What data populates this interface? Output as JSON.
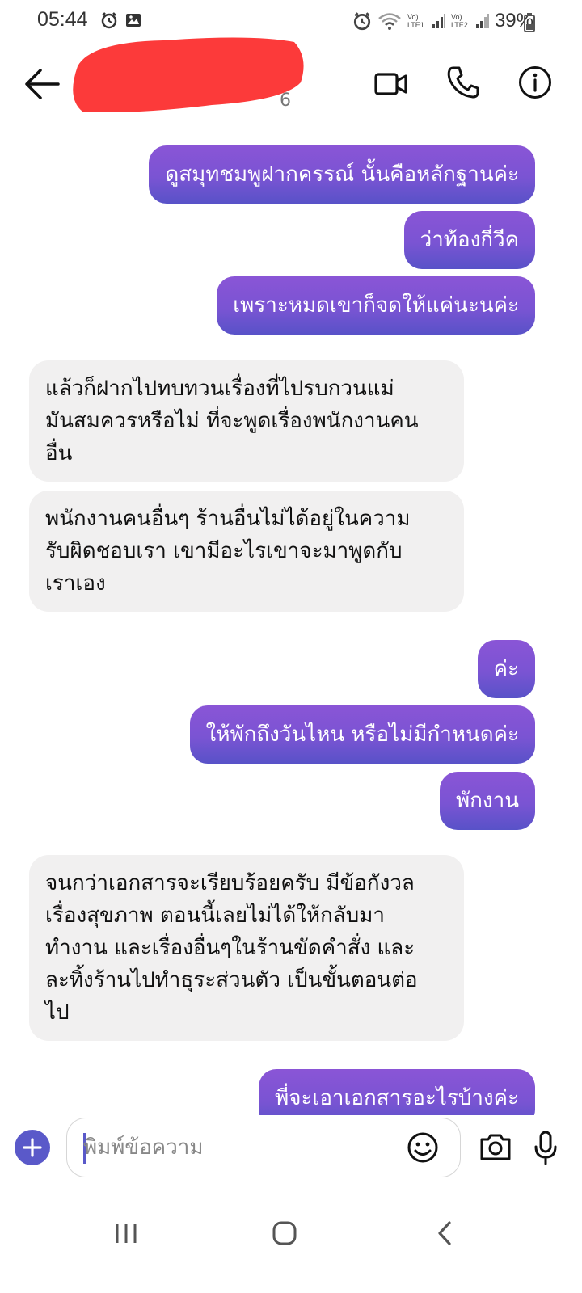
{
  "status_bar": {
    "time": "05:44",
    "battery": "39%",
    "sim1_label": "Vo) LTE1",
    "sim2_label": "Vo) LTE2"
  },
  "header": {
    "contact_name": "",
    "contact_status": "6",
    "redaction_color": "#fc3a3a"
  },
  "colors": {
    "outgoing_gradient_start": "#8a55d6",
    "outgoing_gradient_mid": "#7a54d3",
    "outgoing_gradient_end": "#5852c8",
    "incoming_bg": "#f1f0f0",
    "accent": "#5a59c9"
  },
  "messages": [
    {
      "dir": "out",
      "text": "ดูสมุทชมพูฝากครรณ์ นั้นคือหลักฐานค่ะ"
    },
    {
      "dir": "out",
      "text": "ว่าท้องกี่วีค"
    },
    {
      "dir": "out",
      "text": "เพราะหมดเขาก็จดให้แค่นะนค่ะ"
    },
    {
      "dir": "in",
      "text": "แล้วก็ฝากไปทบทวนเรื่องที่ไปรบกวนแม่\nมันสมควรหรือไม่ ที่จะพูดเรื่องพนักงานคน\nอื่น"
    },
    {
      "dir": "in",
      "text": "พนักงานคนอื่นๆ ร้านอื่นไม่ได้อยู่ในความ\nรับผิดชอบเรา เขามีอะไรเขาจะมาพูดกับ\nเราเอง"
    },
    {
      "dir": "out",
      "text": "ค่ะ"
    },
    {
      "dir": "out",
      "text": "ให้พักถึงวันไหน หรือไม่มีกำหนดค่ะ"
    },
    {
      "dir": "out",
      "text": "พักงาน"
    },
    {
      "dir": "in",
      "text": "จนกว่าเอกสารจะเรียบร้อยครับ มีข้อกังวล\nเรื่องสุขภาพ ตอนนี้เลยไม่ได้ให้กลับมา\nทำงาน และเรื่องอื่นๆในร้านขัดคำสั่ง และ\nละทิ้งร้านไปทำธุระส่วนตัว เป็นขั้นตอนต่อ\nไป"
    },
    {
      "dir": "out",
      "text": "พี่จะเอาเอกสารอะไรบ้างค่ะ"
    }
  ],
  "composer": {
    "placeholder": "พิมพ์ข้อความ"
  },
  "icons": {
    "back": "arrow-left-icon",
    "video": "video-camera-icon",
    "call": "phone-icon",
    "info": "info-icon",
    "plus": "plus-icon",
    "emoji": "smiley-icon",
    "camera": "camera-icon",
    "mic": "microphone-icon"
  }
}
